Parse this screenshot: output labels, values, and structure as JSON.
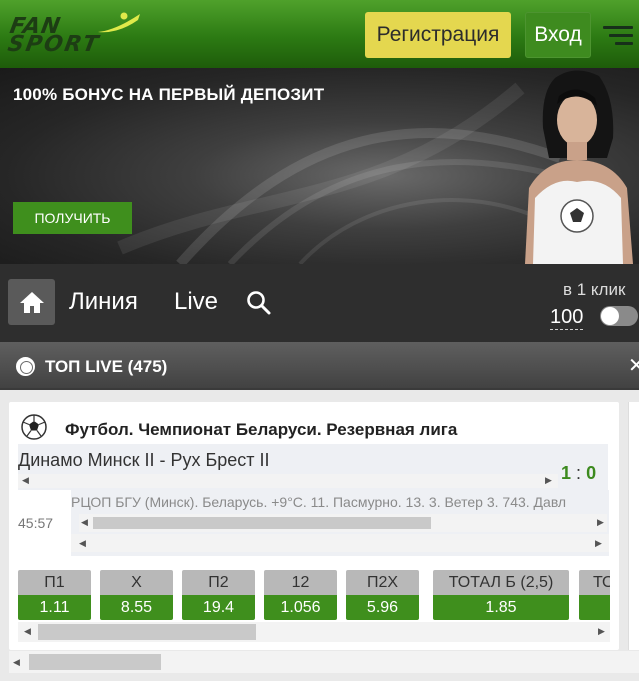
{
  "header": {
    "logo_text_top": "FAN",
    "logo_text_bottom": "SPORT",
    "register_label": "Регистрация",
    "login_label": "Вход",
    "menu_icon": "hamburger-icon"
  },
  "banner": {
    "title": "100% БОНУС НА ПЕРВЫЙ ДЕПОЗИТ",
    "button_label": "ПОЛУЧИТЬ"
  },
  "nav": {
    "home_icon": "home-icon",
    "line_label": "Линия",
    "live_label": "Live",
    "search_icon": "search-icon",
    "one_click_label": "в 1 клик",
    "amount": "100",
    "toggle_on": false
  },
  "section": {
    "title": "ТОП LIVE (475)"
  },
  "match": {
    "league": "Футбол. Чемпионат Беларуси. Резервная лига",
    "teams": "Динамо Минск II - Рух Брест II",
    "score_home": "1",
    "score_sep": ":",
    "score_away": "0",
    "time": "45:57",
    "info": "РЦОП БГУ (Минск). Беларусь. +9°С. 11. Пасмурно. 13. 3. Ветер 3. 743. Давл",
    "odds": [
      {
        "label": "П1",
        "value": "1.11"
      },
      {
        "label": "X",
        "value": "8.55"
      },
      {
        "label": "П2",
        "value": "19.4"
      },
      {
        "label": "12",
        "value": "1.056"
      },
      {
        "label": "П2X",
        "value": "5.96"
      },
      {
        "label": "ТОТАЛ Б (2,5)",
        "value": "1.85"
      },
      {
        "label": "ТО",
        "value": ""
      }
    ]
  },
  "colors": {
    "brand_green": "#3f8f1d",
    "register_yellow": "#e4d74f",
    "score_green": "#3c8a1e"
  }
}
